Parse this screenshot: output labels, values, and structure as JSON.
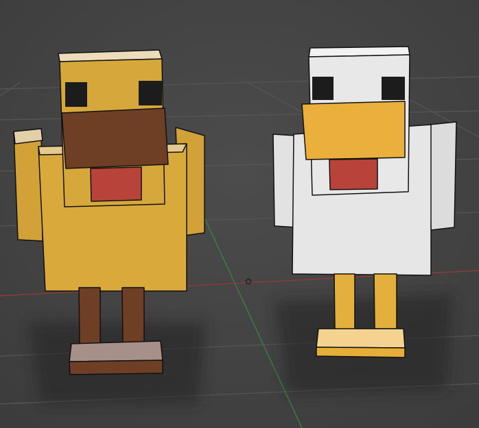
{
  "scene": {
    "colors": {
      "background": "#454545",
      "grid": "#555555",
      "axis_x": "#8a3b3b",
      "axis_y": "#3f7a3f",
      "yellow_chicken_body": "#d6a73a",
      "yellow_chicken_beak": "#6e3f24",
      "yellow_chicken_legs": "#6e3f24",
      "white_chicken_body": "#e6e6e6",
      "white_chicken_beak": "#ebb03c",
      "white_chicken_legs": "#e3b03e",
      "wattle": "#b8433a",
      "eyes": "#1c1c1c"
    }
  }
}
